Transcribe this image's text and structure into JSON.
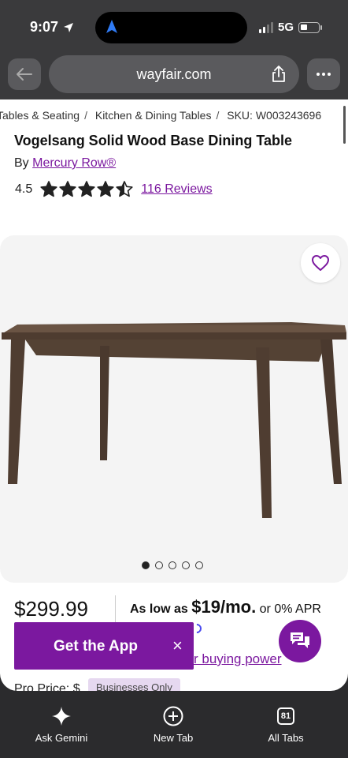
{
  "status_bar": {
    "time": "9:07",
    "network": "5G"
  },
  "browser": {
    "url": "wayfair.com"
  },
  "breadcrumb": [
    "Tables & Seating",
    "Kitchen & Dining Tables",
    "SKU: W003243696"
  ],
  "product": {
    "title": "Vogelsang Solid Wood Base Dining Table",
    "by_prefix": "By",
    "brand": "Mercury Row®",
    "rating": "4.5",
    "rating_value": 4.5,
    "reviews": "116 Reviews",
    "price": "$299.99",
    "financing": {
      "prefix": "As low as",
      "amount": "$19/mo.",
      "suffix": "or 0% APR"
    },
    "buying_power": "r buying power",
    "pro_price": "Pro Price: $",
    "business_badge": "Businesses Only"
  },
  "gallery": {
    "dots": 5,
    "active_index": 0
  },
  "banner": {
    "label": "Get the App",
    "close": "×"
  },
  "bottom_bar": {
    "ask_gemini": "Ask Gemini",
    "new_tab": "New Tab",
    "tab_count": "81",
    "all_tabs": "All Tabs"
  },
  "colors": {
    "brand_purple": "#7b189f",
    "chrome": "#3a3a3c",
    "bottom": "#2b2b2d"
  }
}
